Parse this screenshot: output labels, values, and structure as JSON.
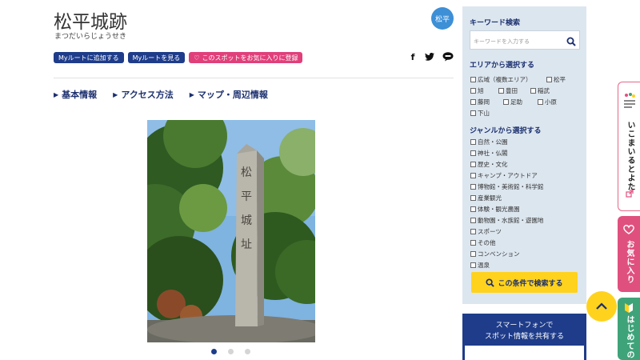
{
  "page": {
    "title": "松平城跡",
    "reading": "まつだいらじょうせき",
    "area_badge": "松平"
  },
  "actions": {
    "add_route": "Myルートに追加する",
    "view_route": "Myルートを見る",
    "favorite": "このスポットをお気に入りに登録"
  },
  "share_icons": [
    "facebook-icon",
    "twitter-icon",
    "line-icon"
  ],
  "share_labels": {
    "facebook": "f",
    "twitter": "t"
  },
  "tabs": [
    {
      "label": "基本情報"
    },
    {
      "label": "アクセス方法"
    },
    {
      "label": "マップ・周辺情報"
    }
  ],
  "gallery": {
    "total": 3,
    "active": 1
  },
  "sidebar": {
    "keyword_heading": "キーワード検索",
    "keyword_placeholder": "キーワードを入力する",
    "area_heading": "エリアから選択する",
    "areas": [
      "広域（複数エリア）",
      "松平",
      "旭",
      "豊田",
      "稲武",
      "藤岡",
      "足助",
      "小原",
      "下山"
    ],
    "genre_heading": "ジャンルから選択する",
    "genres": [
      "自然・公園",
      "神社・仏閣",
      "歴史・文化",
      "キャンプ・アウトドア",
      "博物館・美術館・科学館",
      "産業観光",
      "体験・観光農園",
      "動物園・水族館・遊園地",
      "スポーツ",
      "その他",
      "コンベンション",
      "温泉"
    ],
    "search_button": "この条件で検索する"
  },
  "share_box": {
    "line1": "スマートフォンで",
    "line2": "スポット情報を共有する"
  },
  "float_tabs": {
    "brand": "いこまいるとよた",
    "favorites": "お気に入り",
    "first_time": "はじめての"
  },
  "colors": {
    "navy": "#1e3c8a",
    "pink": "#e0407a",
    "yellow": "#ffd21e",
    "sidebar_bg": "#dce6ef",
    "green": "#3fa37a"
  }
}
